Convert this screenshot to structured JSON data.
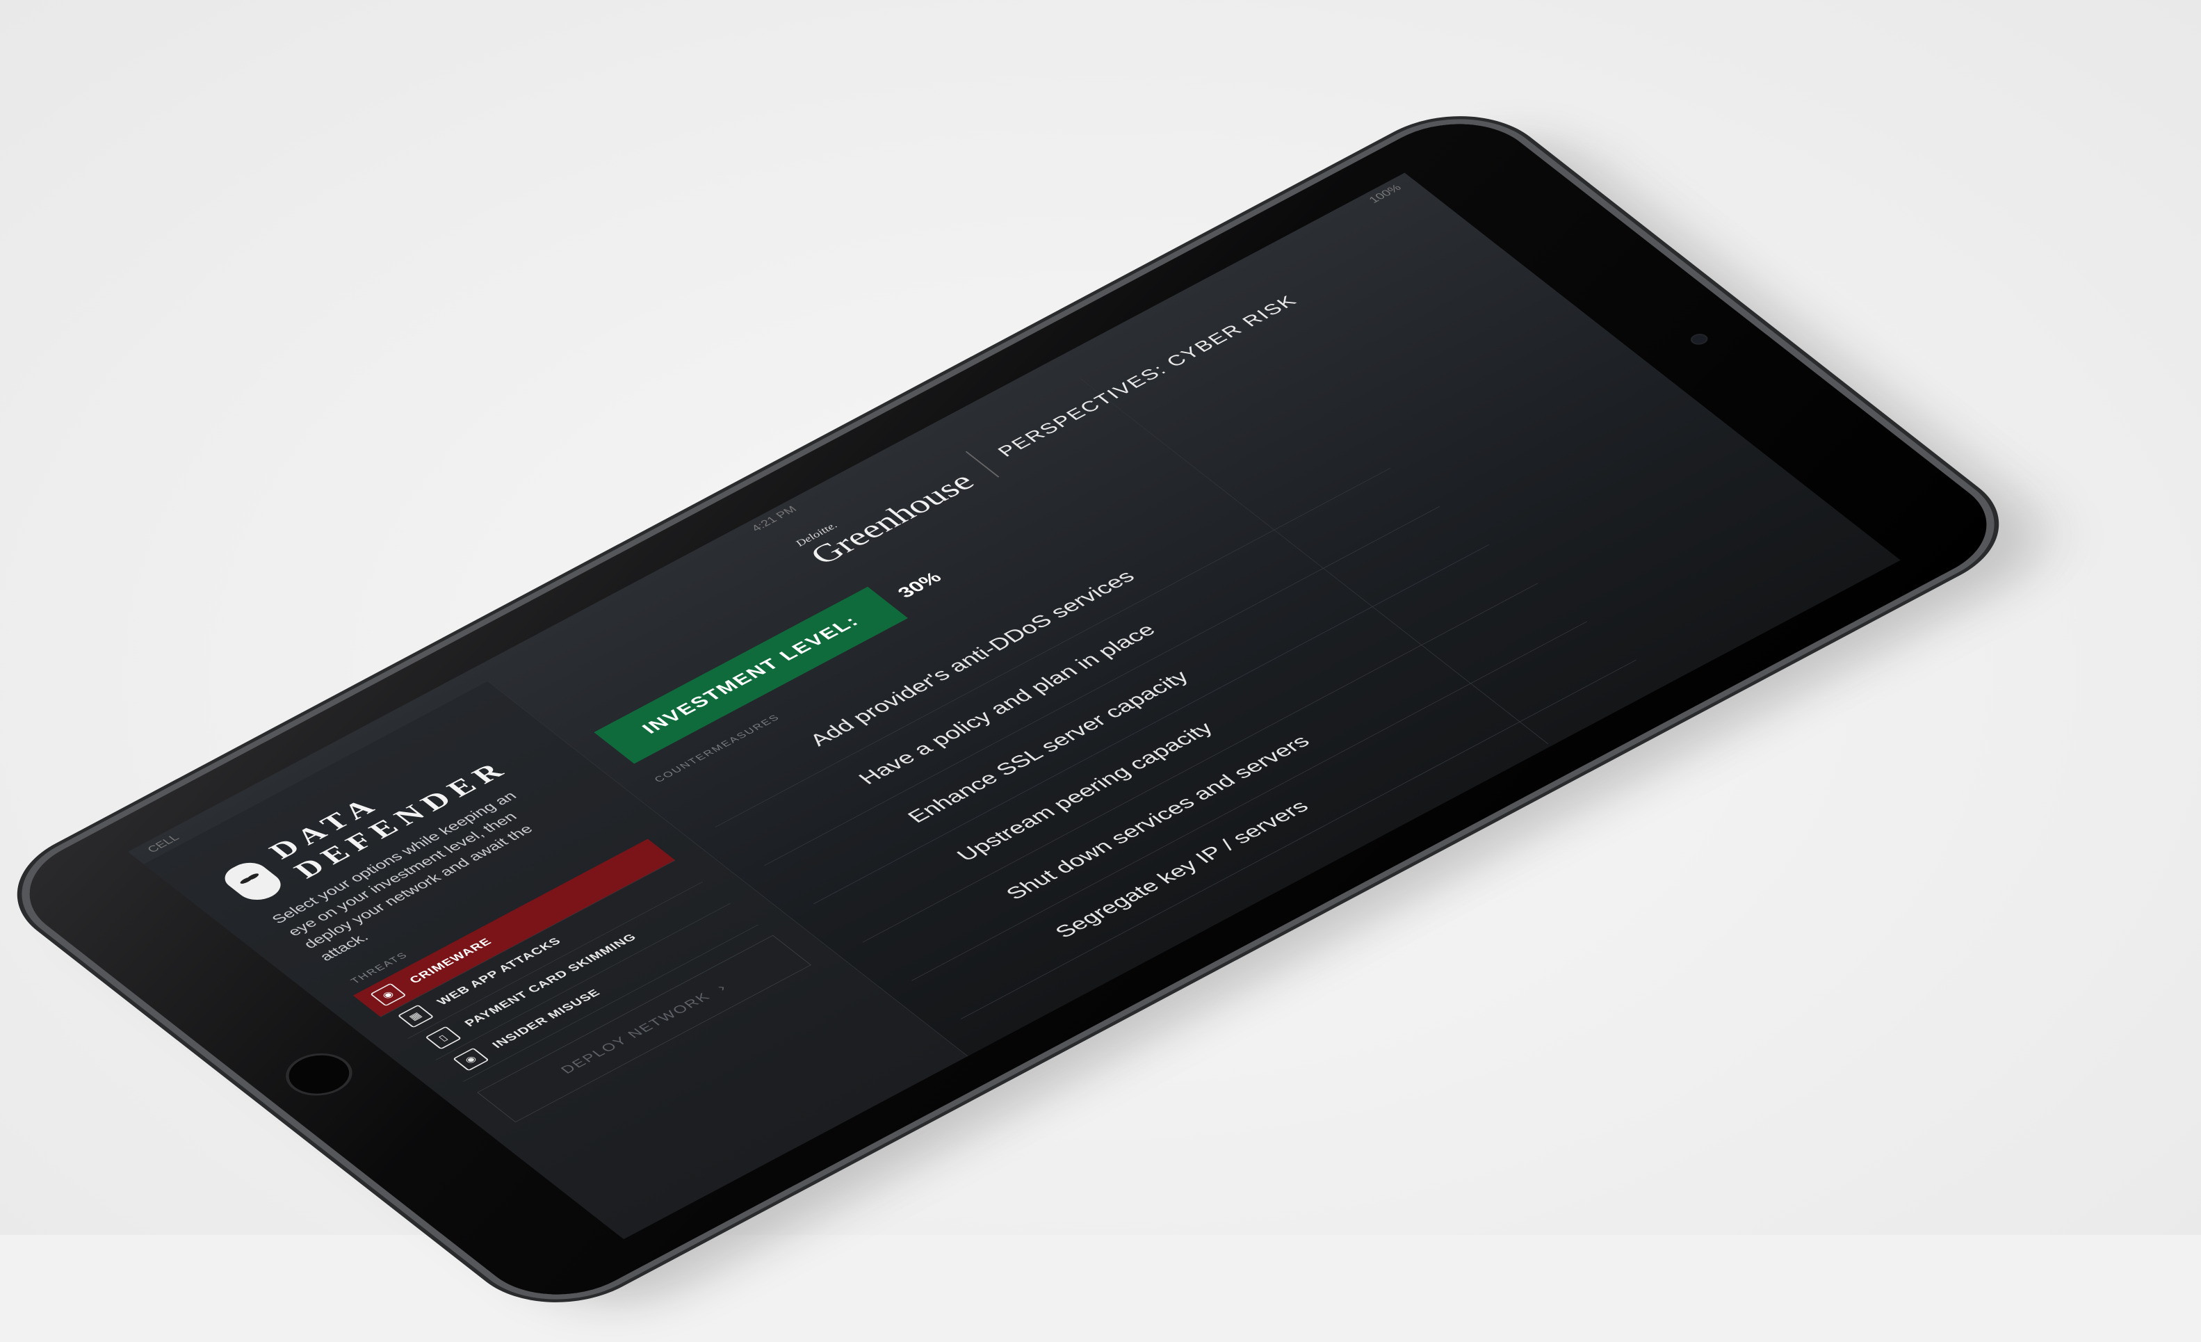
{
  "status": {
    "carrier": "CELL",
    "time": "4:21 PM",
    "battery": "100%"
  },
  "brand": {
    "title": "DATA DEFENDER",
    "mask_icon": "anonymous-mask-icon"
  },
  "intro_text": "Select your options while keeping an eye on your investment level, then deploy your network and await the attack.",
  "threats": {
    "label": "THREATS",
    "items": [
      {
        "label": "CRIMEWARE",
        "icon": "crimeware-icon",
        "selected": true
      },
      {
        "label": "WEB APP ATTACKS",
        "icon": "grid-icon",
        "selected": false
      },
      {
        "label": "PAYMENT CARD SKIMMING",
        "icon": "card-icon",
        "selected": false
      },
      {
        "label": "INSIDER MISUSE",
        "icon": "lock-icon",
        "selected": false
      }
    ]
  },
  "deploy": {
    "label": "DEPLOY NETWORK",
    "icon": "chevron-right-icon"
  },
  "header": {
    "logo_small": "Deloitte.",
    "logo_big": "Greenhouse",
    "title": "PERSPECTIVES: CYBER RISK"
  },
  "investment": {
    "label": "INVESTMENT LEVEL:",
    "value": "30%"
  },
  "countermeasures": {
    "label": "COUNTERMEASURES",
    "items": [
      "Add provider's anti-DDoS services",
      "Have a policy and plan in place",
      "Enhance SSL server capacity",
      "Upstream peering capacity",
      "Shut down services and servers",
      "Segregate key IP / servers"
    ]
  },
  "colors": {
    "selected_threat": "#7a1418",
    "investment_badge": "#0f6b3c",
    "screen_bg": "#1c1f23"
  }
}
